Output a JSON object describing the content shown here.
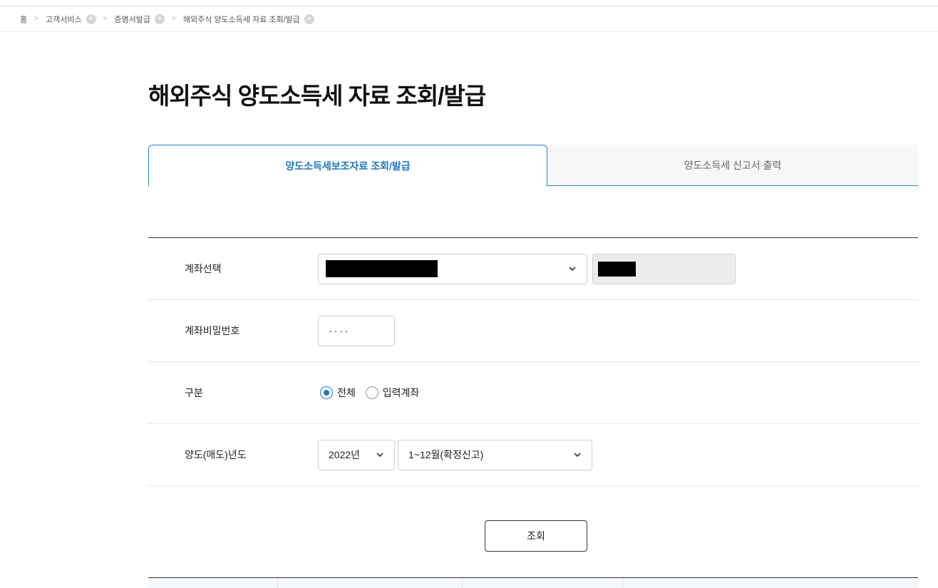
{
  "breadcrumb": {
    "home": "홈",
    "items": [
      "고객서비스",
      "증명서발급",
      "해외주식 양도소득세 자료 조회/발급"
    ]
  },
  "page": {
    "title": "해외주식 양도소득세 자료 조회/발급"
  },
  "tabs": [
    {
      "label": "양도소득세보조자료 조회/발급",
      "active": true
    },
    {
      "label": "양도소득세 신고서 출력",
      "active": false
    }
  ],
  "form": {
    "account": {
      "label": "계좌선택"
    },
    "password": {
      "label": "계좌비밀번호",
      "value": "····"
    },
    "category": {
      "label": "구분",
      "options": [
        {
          "label": "전체",
          "selected": true
        },
        {
          "label": "입력계좌",
          "selected": false
        }
      ]
    },
    "year": {
      "label": "양도(매도)년도",
      "year_value": "2022년",
      "period_value": "1~12월(확정신고)"
    }
  },
  "actions": {
    "search_label": "조회"
  },
  "colors": {
    "accent": "#1f78c0",
    "tab_border": "#2c86c7"
  },
  "icons": {
    "dropdown": "chevron-down-icon",
    "crumb_toggle": "caret-down-icon",
    "crumb_sep": "chevron-right-icon"
  }
}
